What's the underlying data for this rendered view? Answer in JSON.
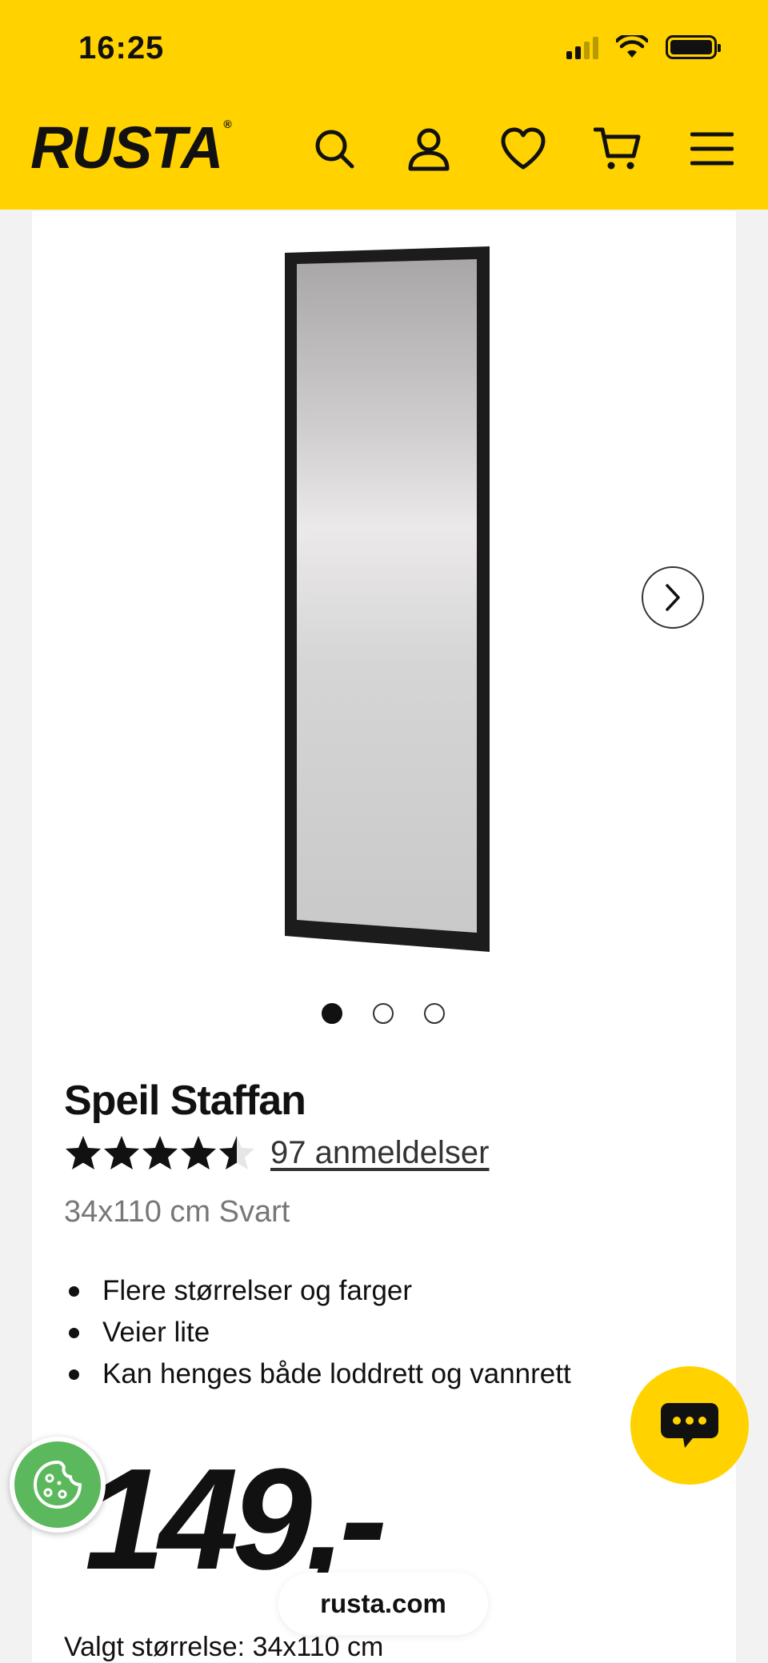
{
  "status_bar": {
    "time": "16:25"
  },
  "header": {
    "logo": "RUSTA",
    "logo_mark": "®",
    "icons": [
      "search-icon",
      "account-icon",
      "heart-icon",
      "cart-icon",
      "menu-icon"
    ],
    "background": "#ffd200"
  },
  "gallery": {
    "image": "mirror",
    "slide_count": 3,
    "active_slide": 1
  },
  "product": {
    "title": "Speil Staffan",
    "rating": 4.5,
    "reviews_label": "97 anmeldelser",
    "variant": "34x110 cm Svart",
    "features": [
      "Flere størrelser og farger",
      "Veier lite",
      "Kan henges både loddrett og vannrett"
    ],
    "price": "149,-",
    "selected_size_label": "Valgt størrelse:",
    "selected_size_value": "34x110 cm"
  },
  "browser": {
    "url": "rusta.com"
  },
  "colors": {
    "brand_yellow": "#ffd200",
    "cookie_green": "#5cb85c"
  }
}
